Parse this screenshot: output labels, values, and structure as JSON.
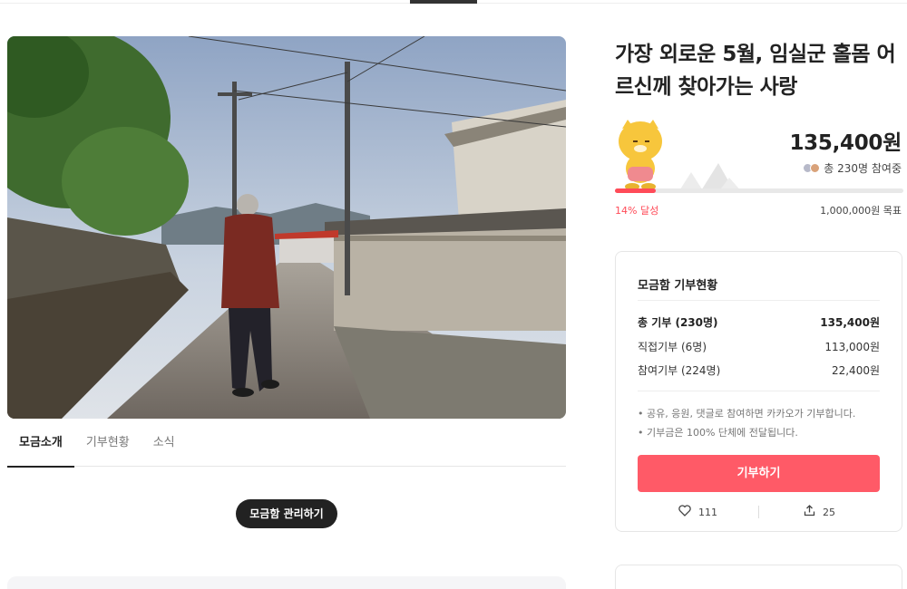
{
  "title": "가장 외로운 5월, 임실군 홀몸 어르신께 찾아가는 사랑",
  "tabs": [
    {
      "label": "모금소개",
      "active": true
    },
    {
      "label": "기부현황",
      "active": false
    },
    {
      "label": "소식",
      "active": false
    }
  ],
  "manage_button": "모금함 관리하기",
  "funding": {
    "amount": "135,400원",
    "participants": "총 230명 참여중",
    "progress_percent": 14,
    "percent_label": "14% 달성",
    "goal": "1,000,000원 목표"
  },
  "status_card": {
    "title": "모금함 기부현황",
    "rows": [
      {
        "label": "총 기부 (230명)",
        "value": "135,400원"
      },
      {
        "label": "직접기부 (6명)",
        "value": "113,000원"
      },
      {
        "label": "참여기부 (224명)",
        "value": "22,400원"
      }
    ],
    "notes": [
      "• 공유, 응원, 댓글로 참여하면 카카오가 기부합니다.",
      "• 기부금은 100% 단체에 전달됩니다."
    ],
    "donate_button": "기부하기",
    "likes": "111",
    "shares": "25"
  },
  "colors": {
    "accent": "#ff5a67",
    "progress": "#ff4b58"
  },
  "icons": {
    "like": "heart-icon",
    "share": "share-icon"
  }
}
